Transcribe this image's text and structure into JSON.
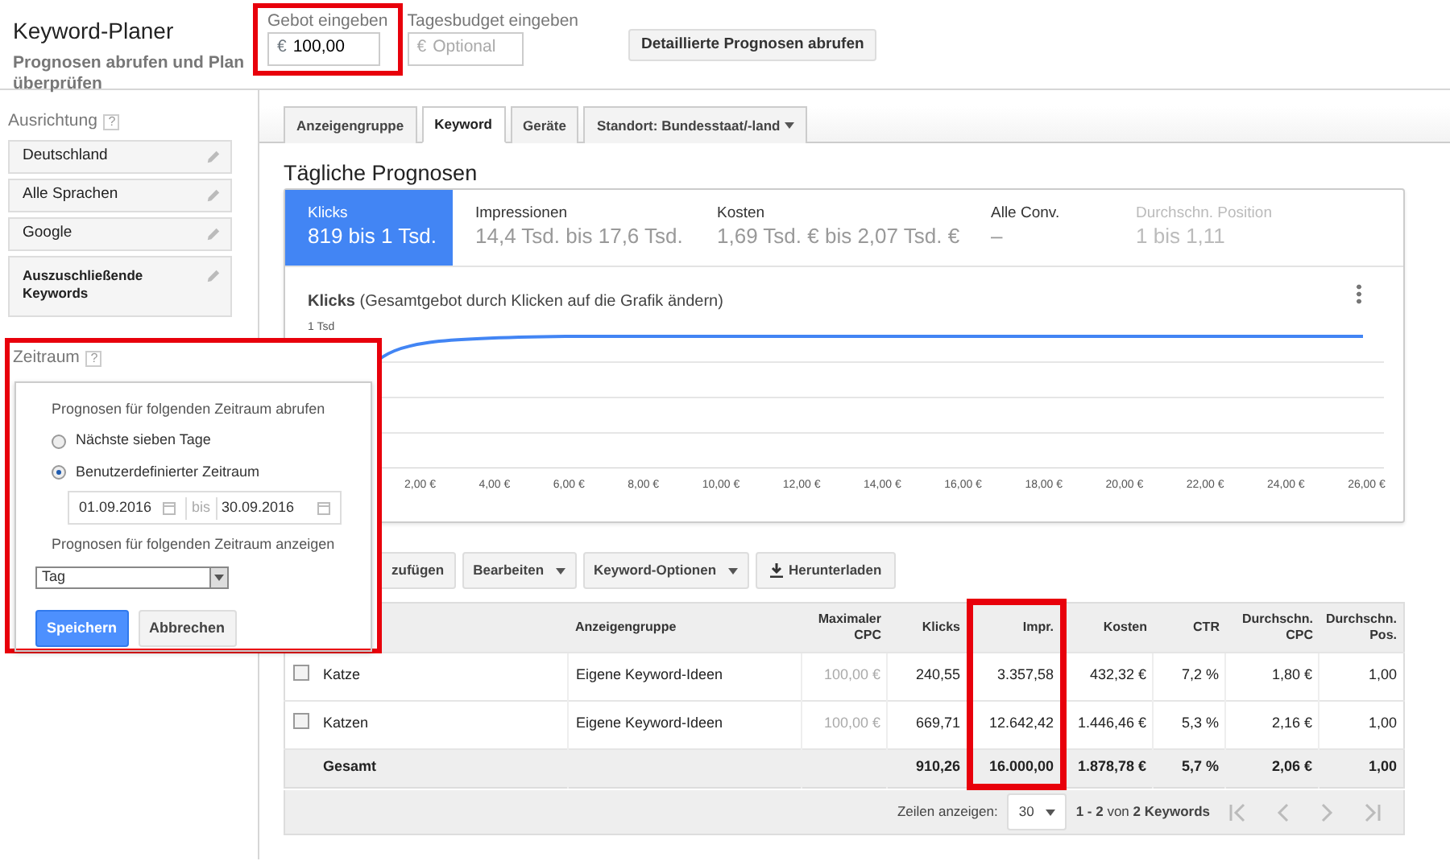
{
  "header": {
    "title": "Keyword-Planer",
    "subtitle": "Prognosen abrufen und Plan überprüfen",
    "bid": {
      "label": "Gebot eingeben",
      "prefix": "€",
      "value": "100,00",
      "highlighted": true
    },
    "budget": {
      "label": "Tagesbudget eingeben",
      "prefix": "€",
      "placeholder": "Optional"
    },
    "button": "Detaillierte Prognosen abrufen"
  },
  "sidebar": {
    "title": "Ausrichtung",
    "help": "?",
    "items": [
      {
        "label": "Deutschland",
        "bold": false
      },
      {
        "label": "Alle Sprachen",
        "bold": false
      },
      {
        "label": "Google",
        "bold": false
      },
      {
        "label": "Auszuschließende Keywords",
        "bold": true
      }
    ]
  },
  "tabs": [
    {
      "label": "Anzeigengruppe",
      "selected": false,
      "dropdown": false
    },
    {
      "label": "Keyword",
      "selected": true,
      "dropdown": false
    },
    {
      "label": "Geräte",
      "selected": false,
      "dropdown": false
    },
    {
      "label": "Standort: Bundesstaat/-land",
      "selected": false,
      "dropdown": true
    }
  ],
  "forecast": {
    "title": "Tägliche Prognosen",
    "metrics": [
      {
        "label": "Klicks",
        "value": "819 bis 1 Tsd.",
        "selected": true,
        "disabled": false
      },
      {
        "label": "Impressionen",
        "value": "14,4 Tsd. bis 17,6 Tsd.",
        "selected": false,
        "disabled": false
      },
      {
        "label": "Kosten",
        "value": "1,69 Tsd. € bis 2,07 Tsd. €",
        "selected": false,
        "disabled": false
      },
      {
        "label": "Alle Conv.",
        "value": "–",
        "selected": false,
        "disabled": false
      },
      {
        "label": "Durchschn. Position",
        "value": "1 bis 1,11",
        "selected": false,
        "disabled": true
      }
    ],
    "chart": {
      "caption": "**Klicks** (Gesamtgebot durch Klicken auf die Grafik ändern)",
      "y_label": "1 Tsd",
      "x_tick_labels": [
        "2,00 €",
        "4,00 €",
        "6,00 €",
        "8,00 €",
        "10,00 €",
        "12,00 €",
        "14,00 €",
        "16,00 €",
        "18,00 €",
        "20,00 €",
        "22,00 €",
        "24,00 €",
        "26,00 €"
      ]
    }
  },
  "toolbar": [
    {
      "label": "zufügen",
      "kind": "button"
    },
    {
      "label": "Bearbeiten",
      "kind": "dropdown"
    },
    {
      "label": "Keyword-Optionen",
      "kind": "dropdown"
    },
    {
      "label": "Herunterladen",
      "kind": "download"
    }
  ],
  "table": {
    "columns": [
      {
        "label": "Anzeigengruppe",
        "highlighted": false
      },
      {
        "label": "Maximaler CPC",
        "highlighted": false
      },
      {
        "label": "Klicks",
        "highlighted": false
      },
      {
        "label": "Impr.",
        "highlighted": true
      },
      {
        "label": "Kosten",
        "highlighted": false
      },
      {
        "label": "CTR",
        "highlighted": false
      },
      {
        "label": "Durchschn. CPC",
        "highlighted": false
      },
      {
        "label": "Durchschn. Pos.",
        "highlighted": false
      }
    ],
    "rows": [
      {
        "checked": false,
        "keyword": "Katze",
        "cells": [
          "Eigene Keyword-Ideen",
          "100,00 €",
          "240,55",
          "3.357,58",
          "432,32 €",
          "7,2 %",
          "1,80 €",
          "1,00"
        ]
      },
      {
        "checked": false,
        "keyword": "Katzen",
        "cells": [
          "Eigene Keyword-Ideen",
          "100,00 €",
          "669,71",
          "12.642,42",
          "1.446,46 €",
          "5,3 %",
          "2,16 €",
          "1,00"
        ]
      }
    ],
    "total": {
      "label": "Gesamt",
      "cells": [
        "910,26",
        "16.000,00",
        "1.878,78 €",
        "5,7 %",
        "2,06 €",
        "1,00"
      ]
    }
  },
  "pagination": {
    "rows_label": "Zeilen anzeigen:",
    "rows_value": "30",
    "range": "**1 - 2** von **2 Keywords**"
  },
  "popover": {
    "title": "Zeitraum",
    "help": "?",
    "highlighted": true,
    "prompt": "Prognosen für folgenden Zeitraum abrufen",
    "options": [
      {
        "label": "Nächste sieben Tage",
        "selected": false
      },
      {
        "label": "Benutzerdefinierter Zeitraum",
        "selected": true
      }
    ],
    "start": "01.09.2016",
    "separator": "bis",
    "end": "30.09.2016",
    "display_prompt": "Prognosen für folgenden Zeitraum anzeigen",
    "granularity": "Tag",
    "save": "Speichern",
    "cancel": "Abbrechen"
  }
}
